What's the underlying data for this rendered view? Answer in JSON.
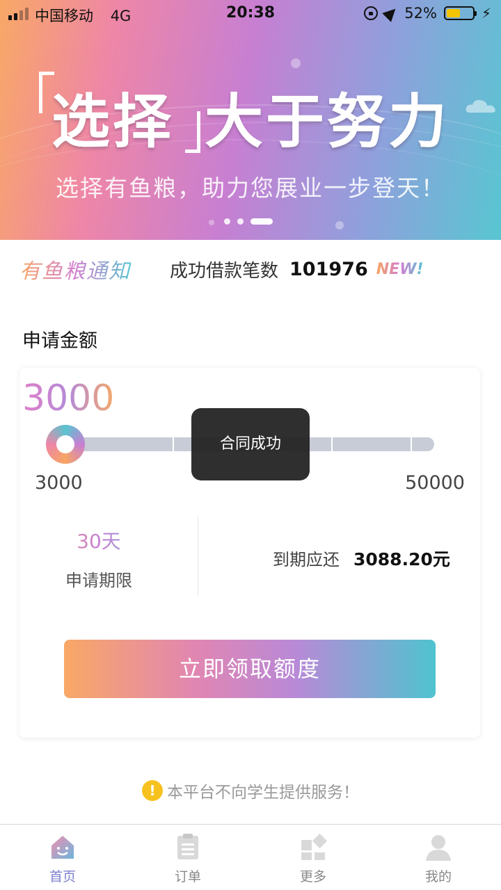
{
  "status_bar": {
    "carrier": "中国移动",
    "network": "4G",
    "time": "20:38",
    "battery": "52%",
    "battery_level": 0.52
  },
  "banner": {
    "title_part1": "选择",
    "title_part2": "大于努力",
    "subtitle": "选择有鱼粮，助力您展业一步登天！",
    "page_count": 3,
    "active_page": 3
  },
  "notice": {
    "title": "有鱼粮通知",
    "text": "成功借款笔数",
    "count": "101976",
    "badge": "NEW!"
  },
  "apply": {
    "section_title": "申请金额",
    "amount": "3000",
    "min_label": "3000",
    "max_label": "50000",
    "slider_value": 3000,
    "slider_min": 3000,
    "slider_max": 50000,
    "term_value": "30天",
    "term_label": "申请期限",
    "due_label": "到期应还",
    "due_value": "3088.20元",
    "cta_label": "立即领取额度"
  },
  "toast": {
    "message": "合同成功"
  },
  "disclaimer": {
    "text": "本平台不向学生提供服务！"
  },
  "tabbar": {
    "tabs": [
      {
        "label": "首页",
        "icon": "home-icon",
        "active": true
      },
      {
        "label": "订单",
        "icon": "order-icon",
        "active": false
      },
      {
        "label": "更多",
        "icon": "more-icon",
        "active": false
      },
      {
        "label": "我的",
        "icon": "profile-icon",
        "active": false
      }
    ]
  },
  "colors": {
    "gradient_start": "#f9a866",
    "gradient_mid": "#c77fd2",
    "gradient_end": "#58c6d1",
    "active_tab": "#7c7fd0",
    "warning": "#f7c21f"
  }
}
